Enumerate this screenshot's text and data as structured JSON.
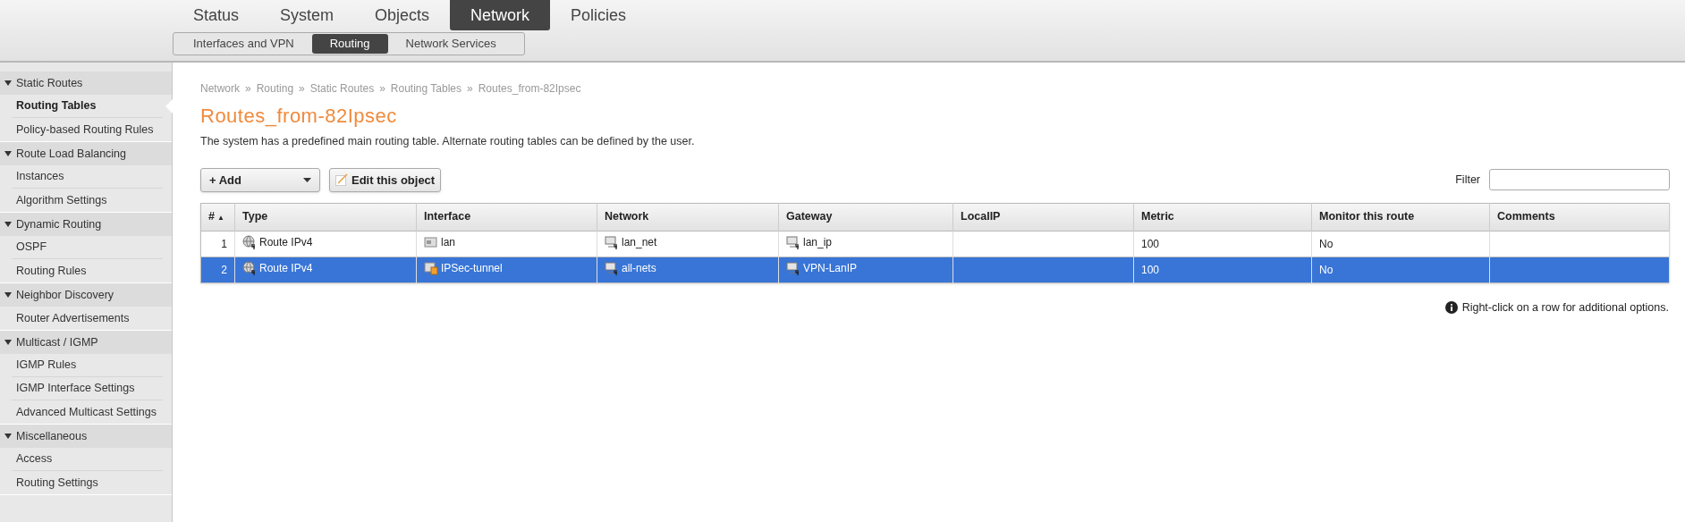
{
  "main_tabs": [
    {
      "label": "Status",
      "selected": false
    },
    {
      "label": "System",
      "selected": false
    },
    {
      "label": "Objects",
      "selected": false
    },
    {
      "label": "Network",
      "selected": true
    },
    {
      "label": "Policies",
      "selected": false
    }
  ],
  "sub_tabs": [
    {
      "label": "Interfaces and VPN",
      "selected": false
    },
    {
      "label": "Routing",
      "selected": true
    },
    {
      "label": "Network Services",
      "selected": false
    }
  ],
  "sidebar": {
    "groups": [
      {
        "label": "Static Routes",
        "expanded": true,
        "items": [
          {
            "label": "Routing Tables",
            "selected": true
          },
          {
            "label": "Policy-based Routing Rules",
            "selected": false
          }
        ]
      },
      {
        "label": "Route Load Balancing",
        "expanded": true,
        "items": [
          {
            "label": "Instances",
            "selected": false
          },
          {
            "label": "Algorithm Settings",
            "selected": false
          }
        ]
      },
      {
        "label": "Dynamic Routing",
        "expanded": true,
        "items": [
          {
            "label": "OSPF",
            "selected": false
          },
          {
            "label": "Routing Rules",
            "selected": false
          }
        ]
      },
      {
        "label": "Neighbor Discovery",
        "expanded": true,
        "items": [
          {
            "label": "Router Advertisements",
            "selected": false
          }
        ]
      },
      {
        "label": "Multicast / IGMP",
        "expanded": true,
        "items": [
          {
            "label": "IGMP Rules",
            "selected": false
          },
          {
            "label": "IGMP Interface Settings",
            "selected": false
          },
          {
            "label": "Advanced Multicast Settings",
            "selected": false
          }
        ]
      },
      {
        "label": "Miscellaneous",
        "expanded": true,
        "items": [
          {
            "label": "Access",
            "selected": false
          },
          {
            "label": "Routing Settings",
            "selected": false
          }
        ]
      }
    ]
  },
  "breadcrumb": [
    "Network",
    "Routing",
    "Static Routes",
    "Routing Tables",
    "Routes_from-82Ipsec"
  ],
  "breadcrumb_separator": "»",
  "title": "Routes_from-82Ipsec",
  "description": "The system has a predefined main routing table. Alternate routing tables can be defined by the user.",
  "toolbar": {
    "add_button": "+ Add",
    "edit_button": "Edit this object",
    "filter_label": "Filter"
  },
  "table": {
    "columns": [
      "#",
      "Type",
      "Interface",
      "Network",
      "Gateway",
      "LocalIP",
      "Metric",
      "Monitor this route",
      "Comments"
    ],
    "sort_indicator": "▲",
    "rows": [
      {
        "selected": false,
        "cells": [
          {
            "text": "1"
          },
          {
            "text": "Route IPv4",
            "kind": "route"
          },
          {
            "text": "lan",
            "kind": "interface"
          },
          {
            "text": "lan_net",
            "kind": "address"
          },
          {
            "text": "lan_ip",
            "kind": "address"
          },
          {
            "text": ""
          },
          {
            "text": "100"
          },
          {
            "text": "No"
          },
          {
            "text": ""
          }
        ]
      },
      {
        "selected": true,
        "cells": [
          {
            "text": "2"
          },
          {
            "text": "Route IPv4",
            "kind": "route"
          },
          {
            "text": "IPSec-tunnel",
            "kind": "tunnel"
          },
          {
            "text": "all-nets",
            "kind": "address"
          },
          {
            "text": "VPN-LanIP",
            "kind": "address"
          },
          {
            "text": ""
          },
          {
            "text": "100"
          },
          {
            "text": "No"
          },
          {
            "text": ""
          }
        ]
      }
    ]
  },
  "hint": "Right-click on a row for additional options."
}
